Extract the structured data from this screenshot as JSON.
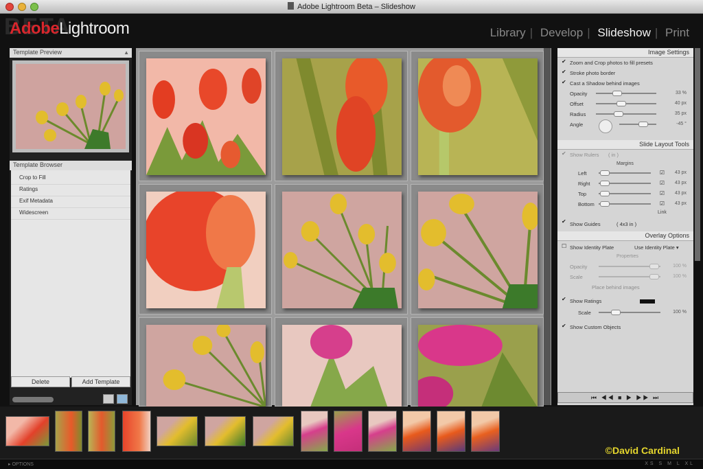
{
  "window": {
    "title": "Adobe Lightroom Beta – Slideshow"
  },
  "header": {
    "logo_ghost": "BETA",
    "logo_adobe": "Adobe",
    "logo_app": "Lightroom",
    "modules": [
      {
        "label": "Library",
        "active": false
      },
      {
        "label": "Develop",
        "active": false
      },
      {
        "label": "Slideshow",
        "active": true
      },
      {
        "label": "Print",
        "active": false
      }
    ],
    "separator": "|"
  },
  "left_panel": {
    "preview_title": "Template Preview",
    "browser_title": "Template Browser",
    "templates": [
      "Crop to Fill",
      "Ratings",
      "Exif Metadata",
      "Widescreen"
    ],
    "delete_label": "Delete",
    "add_label": "Add Template"
  },
  "right_panel": {
    "image_settings": {
      "title": "Image Settings",
      "zoom_label": "Zoom and Crop photos to fill presets",
      "stroke_label": "Stroke photo border",
      "shadow_label": "Cast a Shadow behind images",
      "opacity": {
        "label": "Opacity",
        "value": "33 %",
        "level": 0.33
      },
      "offset": {
        "label": "Offset",
        "value": "40 px",
        "level": 0.4
      },
      "radius": {
        "label": "Radius",
        "value": "35 px",
        "level": 0.35
      },
      "angle": {
        "label": "Angle",
        "value": "-45 °",
        "level": 0.7
      }
    },
    "slide_layout": {
      "title": "Slide Layout Tools",
      "show_rulers": "Show Rulers",
      "rulers_unit": "( in )",
      "margins_label": "Margins",
      "left": {
        "label": "Left",
        "value": "43 px"
      },
      "right": {
        "label": "Right",
        "value": "43 px"
      },
      "top": {
        "label": "Top",
        "value": "43 px"
      },
      "bottom": {
        "label": "Bottom",
        "value": "43 px"
      },
      "link_label": "Link",
      "show_guides": "Show Guides",
      "guides_unit": "( 4x3 in )"
    },
    "overlay": {
      "title": "Overlay Options",
      "identity_label": "Show Identity Plate",
      "identity_value": "Use Identity Plate ▾",
      "properties_label": "Properties",
      "opacity": {
        "label": "Opacity",
        "value": "100 %"
      },
      "scale": {
        "label": "Scale",
        "value": "100 %"
      },
      "place_behind": "Place behind images",
      "ratings_label": "Show Ratings",
      "ratings_scale": {
        "label": "Scale",
        "value": "100 %"
      },
      "custom_label": "Show Custom Objects"
    },
    "playback": "⏮ ◀◀ ■ ▶ ▶▶ ⏭"
  },
  "filmstrip": {
    "copyright": "©David Cardinal"
  },
  "statusbar": {
    "left": "▸ OPTIONS",
    "right": "XS S M L XL"
  },
  "colors": {
    "adobe_red": "#d8262c",
    "copyright_yellow": "#e5d62d",
    "tulip_red": "#e0452b",
    "tulip_yellow": "#e8c033",
    "tulip_pink": "#d83c8c",
    "background_pink": "#d2a8a2"
  }
}
